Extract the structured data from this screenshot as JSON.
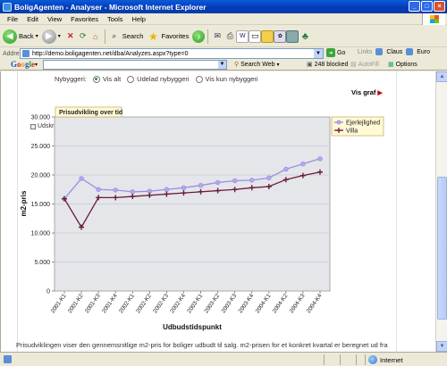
{
  "window": {
    "title": "BoligAgenten - Analyser - Microsoft Internet Explorer",
    "minimize": "_",
    "maximize": "□",
    "close": "×"
  },
  "menu": [
    "File",
    "Edit",
    "View",
    "Favorites",
    "Tools",
    "Help"
  ],
  "toolbar": {
    "back_label": "Back",
    "search_label": "Search",
    "favorites_label": "Favorites"
  },
  "address": {
    "label": "Address",
    "url": "http://demo.boligagenten.net/dba/Analyzes.aspx?type=0",
    "go_label": "Go",
    "links_label": "Links",
    "links": [
      "Claus",
      "Euro"
    ]
  },
  "google_toolbar": {
    "logo": "Google",
    "search_web": "Search Web",
    "blocked": "248 blocked",
    "autofill": "AutoFill",
    "options": "Options"
  },
  "page": {
    "filter_label": "Nybyggeri:",
    "filter_options": [
      {
        "label": "Vis alt",
        "selected": true
      },
      {
        "label": "Udelad nybyggeri",
        "selected": false
      },
      {
        "label": "Vis kun nybyggeri",
        "selected": false
      }
    ],
    "vis_graf": "Vis graf",
    "udskriv": "Udskriv",
    "description": "Prisudviklingen viser den gennemsnitlige m2-pris for boliger udbudt til salg. m2-prisen for et konkret kvartal er beregnet ud fra"
  },
  "status": {
    "zone": "Internet"
  },
  "chart_data": {
    "type": "line",
    "title": "Prisudvikling over tid",
    "xlabel": "Udbudstidspunkt",
    "ylabel": "m2-pris",
    "ylim": [
      0,
      30000
    ],
    "yticks": [
      "0",
      "5.000",
      "10.000",
      "15.000",
      "20.000",
      "25.000",
      "30.000"
    ],
    "grid": true,
    "legend": "top-right",
    "categories": [
      "2001-K1",
      "2001-K2",
      "2001-K3",
      "2001-K4",
      "2002-K1",
      "2002-K2",
      "2002-K3",
      "2002-K4",
      "2003-K1",
      "2003-K2",
      "2003-K3",
      "2003-K4",
      "2004-K1",
      "2004-K2",
      "2004-K3",
      "2004-K4"
    ],
    "series": [
      {
        "name": "Ejerlejlighed",
        "color": "#9b8fe0",
        "marker": "circle",
        "values": [
          15900,
          19400,
          17500,
          17400,
          17100,
          17200,
          17500,
          17800,
          18200,
          18700,
          19000,
          19100,
          19500,
          21000,
          21900,
          22800
        ]
      },
      {
        "name": "Villa",
        "color": "#6b1a3a",
        "marker": "plus",
        "values": [
          15900,
          11000,
          16100,
          16100,
          16300,
          16500,
          16700,
          16900,
          17100,
          17300,
          17500,
          17800,
          18000,
          19200,
          19900,
          20500
        ]
      }
    ]
  }
}
